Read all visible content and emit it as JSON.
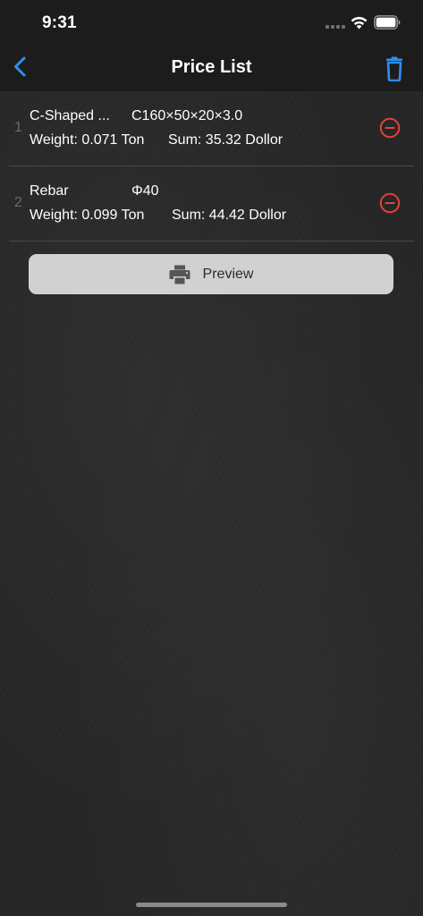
{
  "status_bar": {
    "time": "9:31",
    "icons": [
      "cellular-signal-icon",
      "wifi-icon",
      "battery-icon"
    ]
  },
  "nav_bar": {
    "title": "Price List",
    "back_icon": "chevron-left-icon",
    "trash_icon": "trash-icon"
  },
  "items": [
    {
      "index": "1",
      "name": "C-Shaped ...",
      "spec": "C160×50×20×3.0",
      "weight": "Weight: 0.071 Ton",
      "sum": "Sum: 35.32 Dollor"
    },
    {
      "index": "2",
      "name": "Rebar",
      "spec": "Φ40",
      "weight": "Weight: 0.099 Ton",
      "sum": "Sum: 44.42 Dollor"
    }
  ],
  "preview_button": {
    "label": "Preview",
    "icon": "printer-icon"
  },
  "colors": {
    "accent": "#2f8ff0",
    "remove": "#e5413a",
    "bar_background": "#1c1c1c",
    "button_background": "#d1d1d1"
  }
}
